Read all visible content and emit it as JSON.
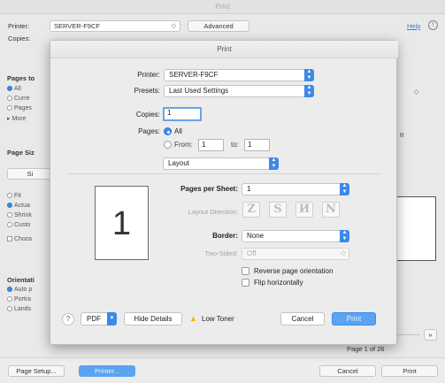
{
  "window": {
    "title": "Print"
  },
  "background": {
    "printer_label": "Printer:",
    "printer_value": "SERVER-F9CF",
    "advanced_button": "Advanced",
    "help_link": "Help",
    "copies_label": "Copies:",
    "pages_section": "Pages to",
    "pages_options": [
      "All",
      "Curre",
      "Pages",
      "More"
    ],
    "page_size_section": "Page Siz",
    "page_size_button": "Si",
    "scale_options": [
      "Fit",
      "Actua",
      "Shrink",
      "Custo"
    ],
    "choose_checkbox": "Choos",
    "orientation_section": "Orientati",
    "orientation_options": [
      "Auto p",
      "Portra",
      "Lands"
    ],
    "right_select_arrow": "◇",
    "right_letter": "n",
    "page_indicator": "Page 1 of 26",
    "next_page_button": "»",
    "page_setup_button": "Page Setup...",
    "printer_button": "Printer...",
    "cancel_button": "Cancel",
    "print_button": "Print"
  },
  "dialog": {
    "title": "Print",
    "printer_label": "Printer:",
    "printer_value": "SERVER-F9CF",
    "presets_label": "Presets:",
    "presets_value": "Last Used Settings",
    "copies_label": "Copies:",
    "copies_value": "1",
    "pages_label": "Pages:",
    "pages_all": "All",
    "pages_from_label": "From:",
    "pages_from_value": "1",
    "pages_to_label": "to:",
    "pages_to_value": "1",
    "section_popup_value": "Layout",
    "preview_page_number": "1",
    "pages_per_sheet_label": "Pages per Sheet:",
    "pages_per_sheet_value": "1",
    "layout_direction_label": "Layout Direction:",
    "layout_directions": [
      "Z",
      "S",
      "И",
      "N"
    ],
    "border_label": "Border:",
    "border_value": "None",
    "two_sided_label": "Two-Sided:",
    "two_sided_value": "Off",
    "reverse_orientation_label": "Reverse page orientation",
    "flip_horizontally_label": "Flip horizontally",
    "help_button": "?",
    "pdf_button": "PDF",
    "hide_details_button": "Hide Details",
    "low_toner_label": "Low Toner",
    "cancel_button": "Cancel",
    "print_button": "Print"
  },
  "colors": {
    "accent": "#3b8ae8",
    "primary_button": "#5aa4f2",
    "warning": "#f2b705"
  }
}
